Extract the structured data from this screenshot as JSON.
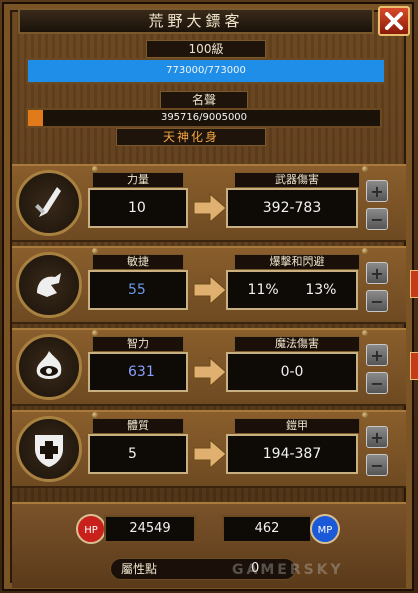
{
  "title": "荒野大鏢客",
  "level_label": "100級",
  "xp": {
    "text": "773000/773000",
    "fraction": 1.0,
    "color": "#1e8ee8"
  },
  "fame_label": "名聲",
  "fame": {
    "text": "395716/9005000",
    "fraction": 0.044,
    "color": "#e07a1a"
  },
  "rank_title": "天神化身",
  "stats": [
    {
      "attr_label": "力量",
      "attr_value": "10",
      "attr_color": "#f2f2f2",
      "result_label": "武器傷害",
      "result_value": "392-783",
      "icon": "sword-fist-icon"
    },
    {
      "attr_label": "敏捷",
      "attr_value": "55",
      "attr_color": "#6a9ae8",
      "result_label": "爆擊和閃避",
      "result_value": "11%      13%",
      "icon": "hand-dodge-icon"
    },
    {
      "attr_label": "智力",
      "attr_value": "631",
      "attr_color": "#8aa0ff",
      "result_label": "魔法傷害",
      "result_value": "0-0",
      "icon": "flame-eye-icon"
    },
    {
      "attr_label": "體質",
      "attr_value": "5",
      "attr_color": "#f2f2f2",
      "result_label": "鎧甲",
      "result_value": "194-387",
      "icon": "shield-cross-icon"
    }
  ],
  "plus_symbol": "+",
  "minus_symbol": "−",
  "hp": {
    "label": "HP",
    "value": "24549",
    "color": "#c8201a"
  },
  "mp": {
    "label": "MP",
    "value": "462",
    "color": "#1a5ad8"
  },
  "points": {
    "label": "屬性點",
    "value": "0"
  },
  "watermark": "GAMERSKY"
}
